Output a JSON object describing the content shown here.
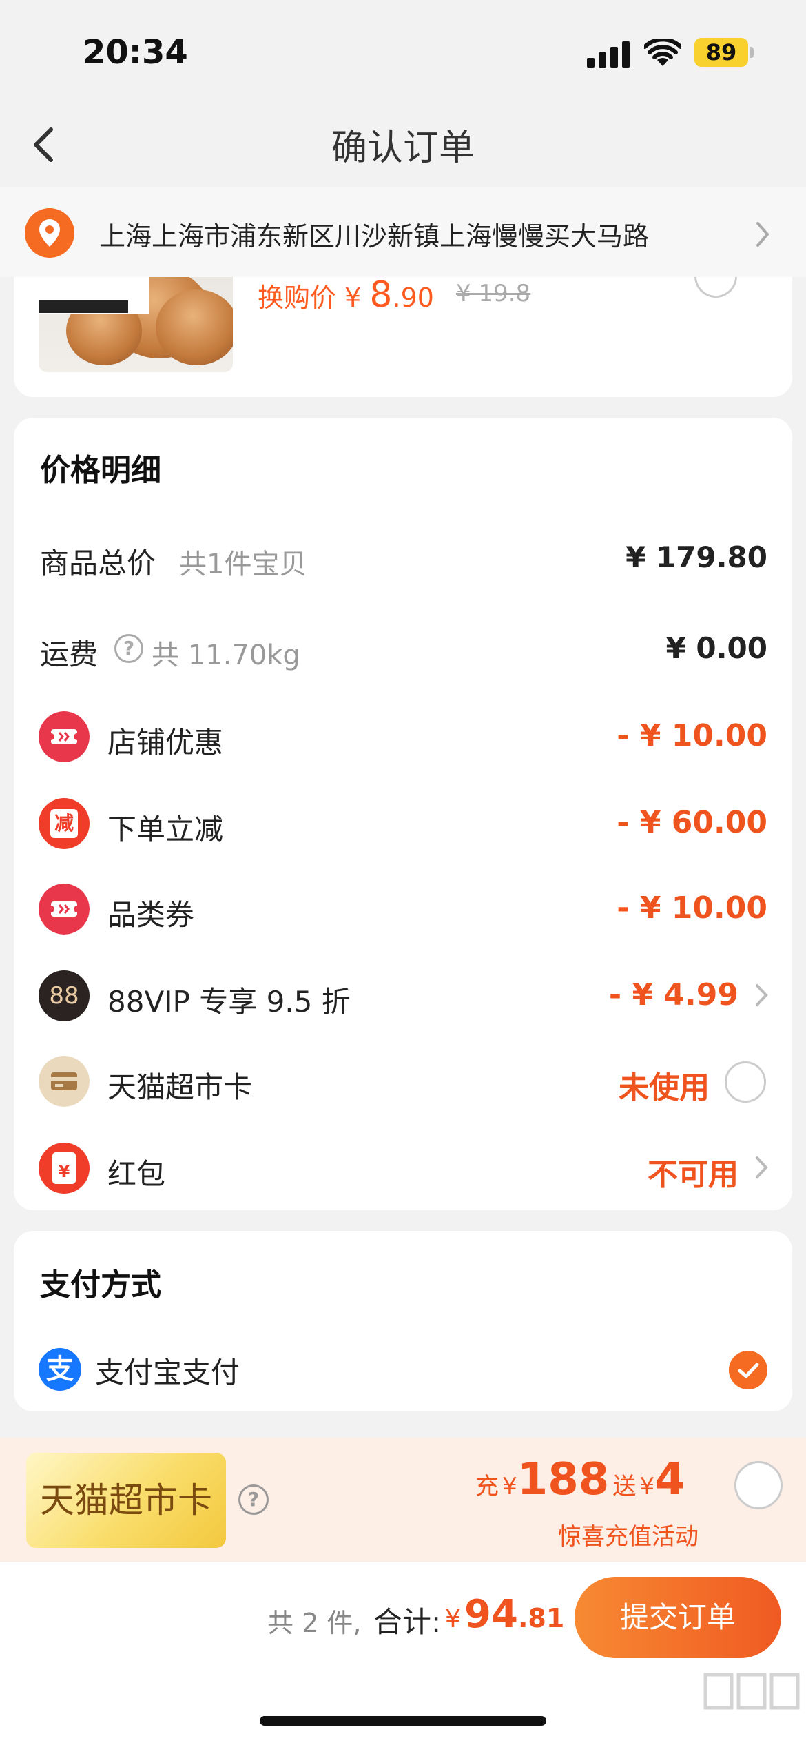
{
  "status_bar": {
    "time": "20:34",
    "battery": "89"
  },
  "nav": {
    "title": "确认订单"
  },
  "address": {
    "text": "上海上海市浦东新区川沙新镇上海慢慢买大马路"
  },
  "product": {
    "swap_label": "换购价",
    "currency": "¥",
    "price_int": "8",
    "price_dec": ".90",
    "original_price": "¥ 19.8"
  },
  "price_detail": {
    "title": "价格明细",
    "subtotal": {
      "label": "商品总价",
      "sub": "共1件宝贝",
      "value": "¥ 179.80"
    },
    "shipping": {
      "label": "运费",
      "sub": "共 11.70kg",
      "value": "¥ 0.00"
    },
    "rows": [
      {
        "label": "店铺优惠",
        "value": "- ¥ 10.00",
        "icon": "coupon-icon",
        "color": "#e8374a"
      },
      {
        "label": "下单立减",
        "value": "- ¥ 60.00",
        "icon": "reduce-icon",
        "color": "#ef3d2a"
      },
      {
        "label": "品类券",
        "value": "- ¥ 10.00",
        "icon": "coupon-icon",
        "color": "#e8374a"
      },
      {
        "label": "88VIP 专享 9.5 折",
        "value": "- ¥ 4.99",
        "icon": "vip88-icon",
        "color": "#2b2321"
      },
      {
        "label": "天猫超市卡",
        "value": "未使用",
        "icon": "card-icon",
        "color": "#ead9bd"
      },
      {
        "label": "红包",
        "value": "不可用",
        "icon": "red-envelope-icon",
        "color": "#ef3d2a"
      }
    ],
    "vip_icon_text": "88",
    "reduce_icon_text": "减",
    "envelope_icon_text": "¥"
  },
  "payment": {
    "title": "支付方式",
    "method": "支付宝支付",
    "alipay_icon_text": "支"
  },
  "promo": {
    "card_label": "天猫超市卡",
    "charge_word": "充",
    "currency": "¥",
    "charge_amount": "188",
    "gift_word": "送",
    "gift_amount": "4",
    "subtitle": "惊喜充值活动"
  },
  "footer": {
    "count": "共 2 件,",
    "total_label": "合计:",
    "currency": "¥",
    "total_int": "94",
    "total_dec": ".81",
    "submit_label": "提交订单"
  },
  "colors": {
    "accent": "#f0541e",
    "alipay": "#1677ff"
  }
}
